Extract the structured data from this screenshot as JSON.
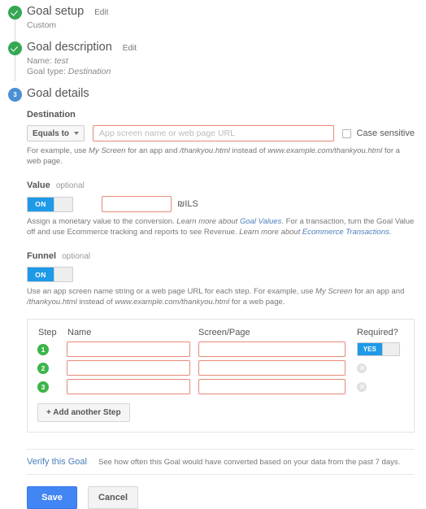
{
  "steps": {
    "goal_setup": {
      "title": "Goal setup",
      "edit": "Edit",
      "value": "Custom"
    },
    "goal_description": {
      "title": "Goal description",
      "edit": "Edit",
      "name_line": "Name: ",
      "name_value": "test",
      "type_line": "Goal type: ",
      "type_value": "Destination"
    },
    "goal_details": {
      "badge": "3",
      "title": "Goal details"
    }
  },
  "destination": {
    "label": "Destination",
    "match_type": "Equals to",
    "placeholder": "App screen name or web page URL",
    "value": "",
    "case_sensitive_label": "Case sensitive",
    "case_sensitive_checked": false,
    "helper_prefix": "For example, use ",
    "helper_em1": "My Screen",
    "helper_mid1": " for an app and ",
    "helper_em2": "/thankyou.html",
    "helper_mid2": " instead of ",
    "helper_em3": "www.example.com/thankyou.html",
    "helper_suffix": " for a web page."
  },
  "value_section": {
    "label": "Value",
    "optional": "optional",
    "toggle_state": "ON",
    "input_value": "",
    "currency": "₪ILS",
    "helper_1": "Assign a monetary value to the conversion. ",
    "helper_link_lead_1": "Learn more about ",
    "helper_link_1": "Goal Values",
    "helper_2": ". For a transaction, turn the Goal Value off and use Ecommerce tracking and reports to see Revenue. ",
    "helper_link_lead_2": "Learn more about ",
    "helper_link_2": "Ecommerce Transactions",
    "helper_3": "."
  },
  "funnel_section": {
    "label": "Funnel",
    "optional": "optional",
    "toggle_state": "ON",
    "helper_prefix": "Use an app screen name string or a web page URL for each step. For example, use ",
    "helper_em1": "My Screen",
    "helper_mid1": " for an app and ",
    "helper_em2": "/thankyou.html",
    "helper_mid2": " instead of ",
    "helper_em3": "www.example.com/thankyou.html",
    "helper_suffix": " for a web page.",
    "columns": {
      "step": "Step",
      "name": "Name",
      "screen": "Screen/Page",
      "required": "Required?"
    },
    "rows": [
      {
        "number": "1",
        "name": "",
        "screen": "",
        "required_toggle": "YES",
        "has_toggle": true
      },
      {
        "number": "2",
        "name": "",
        "screen": "",
        "has_toggle": false
      },
      {
        "number": "3",
        "name": "",
        "screen": "",
        "has_toggle": false
      }
    ],
    "add_step_label": "+ Add another Step"
  },
  "footer": {
    "verify_link": "Verify this Goal",
    "verify_desc": "See how often this Goal would have converted based on your data from the past 7 days.",
    "save_label": "Save",
    "cancel_label": "Cancel"
  }
}
